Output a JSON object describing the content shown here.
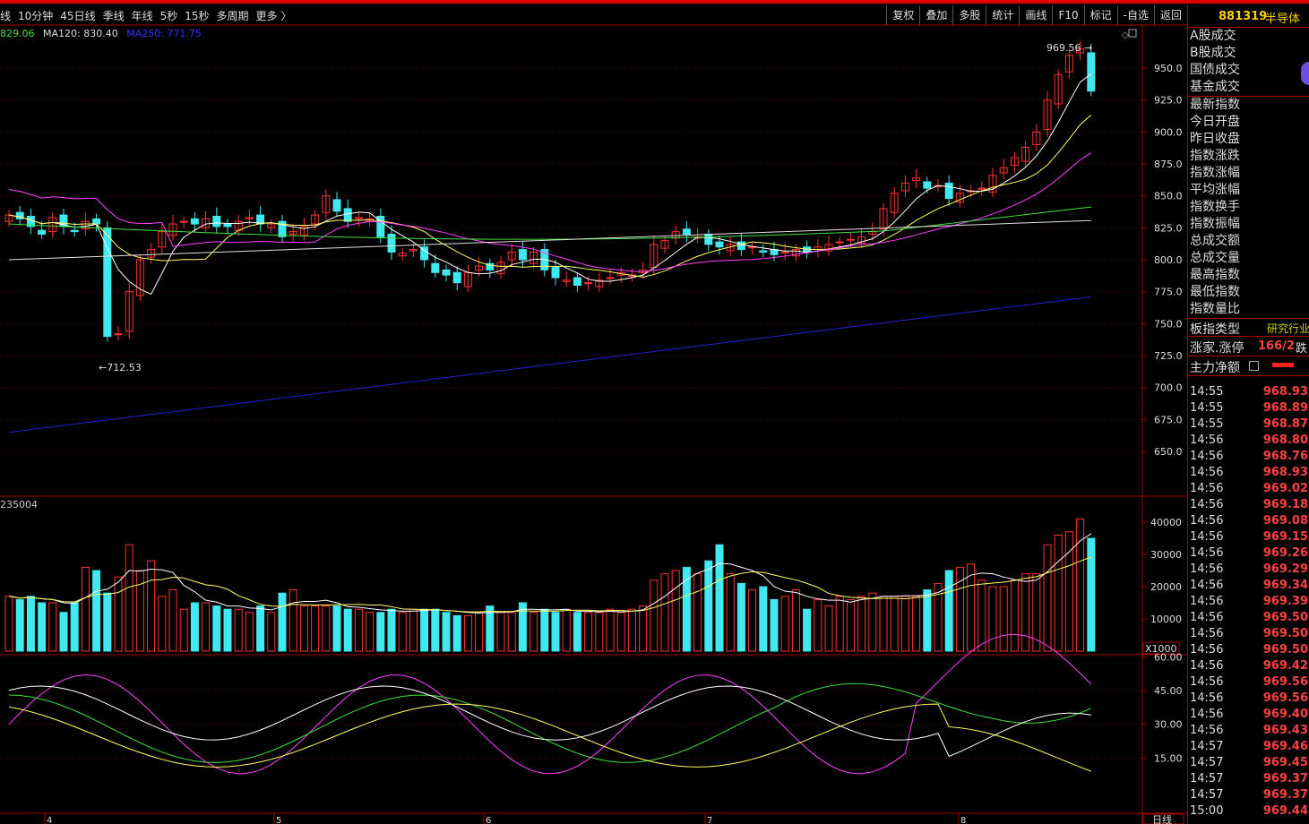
{
  "toolbar": {
    "periods": [
      "线",
      "10分钟",
      "45日线",
      "季线",
      "年线",
      "5秒",
      "15秒",
      "多周期",
      "更多 〉"
    ],
    "buttons": [
      "复权",
      "叠加",
      "多股",
      "统计",
      "画线",
      "F10",
      "标记",
      "-自选",
      "返回"
    ]
  },
  "ma_legend": {
    "ma_x": "829.06",
    "ma120": "MA120: 830.40",
    "ma250": "MA250: 771.75"
  },
  "price_axis": [
    "950.0",
    "925.0",
    "900.0",
    "875.0",
    "850.0",
    "825.0",
    "800.0",
    "775.0",
    "750.0",
    "725.0",
    "700.0",
    "675.0",
    "650.0"
  ],
  "high_label": "969.56",
  "low_label": "712.53",
  "volume": {
    "label": "235004",
    "axis": [
      "40000",
      "30000",
      "20000",
      "10000"
    ],
    "unit": "X1000"
  },
  "indicator_axis": [
    "60.00",
    "45.00",
    "30.00",
    "15.00"
  ],
  "date_axis": [
    "4",
    "5",
    "6",
    "7",
    "8"
  ],
  "bottom_tag": "日线",
  "side": {
    "code": "881319",
    "name": "半导体",
    "items_top": [
      "A股成交",
      "B股成交",
      "国债成交",
      "基金成交"
    ],
    "items_mid": [
      "最新指数",
      "今日开盘",
      "昨日收盘",
      "指数涨跌",
      "指数涨幅",
      "平均涨幅",
      "指数换手",
      "指数振幅",
      "总成交额",
      "总成交量",
      "最高指数",
      "最低指数",
      "指数量比"
    ],
    "board_type_label": "板指类型",
    "board_type_value": "研究行业",
    "up_label": "涨家.涨停",
    "up_value": "166/2",
    "up_suffix": "跌",
    "flow_label": "主力净额",
    "ticks": [
      [
        "14:55",
        "968.93"
      ],
      [
        "14:55",
        "968.89"
      ],
      [
        "14:55",
        "968.87"
      ],
      [
        "14:56",
        "968.80"
      ],
      [
        "14:56",
        "968.76"
      ],
      [
        "14:56",
        "968.93"
      ],
      [
        "14:56",
        "969.02"
      ],
      [
        "14:56",
        "969.18"
      ],
      [
        "14:56",
        "969.08"
      ],
      [
        "14:56",
        "969.15"
      ],
      [
        "14:56",
        "969.26"
      ],
      [
        "14:56",
        "969.29"
      ],
      [
        "14:56",
        "969.34"
      ],
      [
        "14:56",
        "969.39"
      ],
      [
        "14:56",
        "969.50"
      ],
      [
        "14:56",
        "969.50"
      ],
      [
        "14:56",
        "969.50"
      ],
      [
        "14:56",
        "969.42"
      ],
      [
        "14:56",
        "969.56"
      ],
      [
        "14:56",
        "969.56"
      ],
      [
        "14:56",
        "969.40"
      ],
      [
        "14:56",
        "969.43"
      ],
      [
        "14:57",
        "969.46"
      ],
      [
        "14:57",
        "969.45"
      ],
      [
        "14:57",
        "969.37"
      ],
      [
        "14:57",
        "969.37"
      ],
      [
        "15:00",
        "969.44"
      ]
    ]
  },
  "colors": {
    "up": "#ff3030",
    "down": "#40e8f0",
    "ma5": "#ffffff",
    "ma10": "#ffff60",
    "ma20": "#ff40ff",
    "ma60": "#40e040",
    "ma120": "#e0e0e0",
    "ma250": "#2020d0"
  }
}
